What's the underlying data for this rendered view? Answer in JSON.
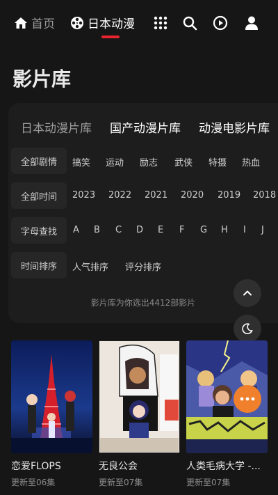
{
  "nav": {
    "home_label": "首页",
    "anime_label": "日本动漫",
    "icons": [
      "grid-icon",
      "search-icon",
      "play-history-icon",
      "user-icon"
    ]
  },
  "page_title": "影片库",
  "library_tabs": [
    "日本动漫片库",
    "国产动漫片库",
    "动漫电影片库"
  ],
  "filters": {
    "genre": {
      "label": "全部剧情",
      "options": [
        "搞笑",
        "运动",
        "励志",
        "武侠",
        "特摄",
        "热血"
      ]
    },
    "year": {
      "label": "全部时间",
      "options": [
        "2023",
        "2022",
        "2021",
        "2020",
        "2019",
        "2018"
      ]
    },
    "letter": {
      "label": "字母查找",
      "options": [
        "A",
        "B",
        "C",
        "D",
        "E",
        "F",
        "G",
        "H",
        "I",
        "J"
      ]
    },
    "sort": {
      "label": "时间排序",
      "options": [
        "人气排序",
        "评分排序"
      ]
    }
  },
  "result_text": "影片库为你选出4412部影片",
  "cards": [
    {
      "title": "恋爱FLOPS",
      "subtitle": "更新至06集"
    },
    {
      "title": "无良公会",
      "subtitle": "更新至07集"
    },
    {
      "title": "人类毛病大学 -...",
      "subtitle": "更新至07集"
    }
  ],
  "colors": {
    "accent": "#e8242f",
    "background": "#161616",
    "panel": "#1d1d1d",
    "orange": "#f0802b"
  }
}
